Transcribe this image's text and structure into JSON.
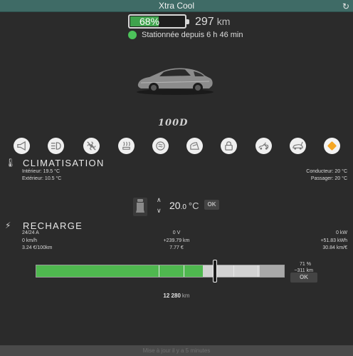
{
  "window": {
    "title": "Xtra Cool",
    "refresh_icon": "refresh-icon"
  },
  "battery": {
    "percent": 0.68,
    "percent_label": "68%",
    "range_value": "297",
    "range_unit": "km"
  },
  "status": {
    "text": "Stationnée depuis 6 h 46 min",
    "dot_color": "#4cc25a"
  },
  "car": {
    "model_badge": "100D"
  },
  "controls": [
    {
      "icon": "horn-icon"
    },
    {
      "icon": "headlights-icon"
    },
    {
      "icon": "fan-off-icon"
    },
    {
      "icon": "seat-heater-icon"
    },
    {
      "icon": "defrost-icon"
    },
    {
      "icon": "falcon-wing-icon"
    },
    {
      "icon": "lock-icon"
    },
    {
      "icon": "frunk-icon"
    },
    {
      "icon": "trunk-icon"
    },
    {
      "icon": "sentry-icon",
      "active_color": "#f5a623"
    }
  ],
  "climate": {
    "title": "CLIMATISATION",
    "interior_label": "Intérieur:",
    "interior_value": "19.5",
    "interior_unit": "°C",
    "exterior_label": "Extérieur:",
    "exterior_value": "10.5",
    "exterior_unit": "°C",
    "driver_label": "Conducteur:",
    "driver_value": "20",
    "driver_unit": "°C",
    "passenger_label": "Passager:",
    "passenger_value": "20",
    "passenger_unit": "°C",
    "setpoint_int": "20",
    "setpoint_dec": ".0",
    "setpoint_unit": "°C",
    "ok_label": "OK"
  },
  "charging": {
    "title": "RECHARGE",
    "current": "24/24",
    "current_unit": "A",
    "speed": "0",
    "speed_unit": "km/h",
    "consumption": "3.24",
    "consumption_unit": "€/100km",
    "voltage": "0",
    "voltage_unit": "V",
    "added_range": "+239.79",
    "added_range_unit": "km",
    "cost": "7.77",
    "cost_unit": "€",
    "power": "0",
    "power_unit": "kW",
    "energy_added": "+51.83",
    "energy_added_unit": "kWh",
    "price": "30.84",
    "price_unit": "km/€",
    "charge_level": 0.68,
    "limit_level": 0.71,
    "limit_percent": "71",
    "limit_percent_unit": "%",
    "limit_range": "~311",
    "limit_range_unit": "km",
    "ok_label": "OK"
  },
  "odometer": {
    "value": "12 280",
    "unit": "km"
  },
  "footer": {
    "text": "Mise à jour il y a 5 minutes"
  }
}
